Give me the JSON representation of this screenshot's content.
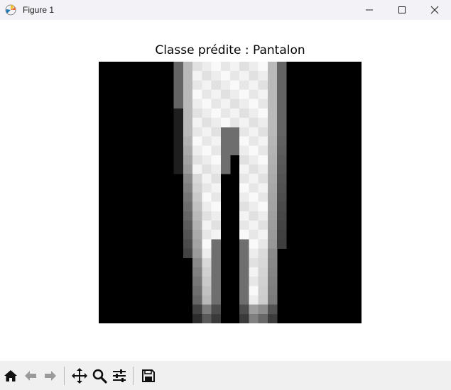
{
  "window": {
    "title": "Figure 1"
  },
  "plot": {
    "title": "Classe prédite : Pantalon"
  },
  "image": {
    "description_type": "grayscale 28x28 pixel image (trousers)",
    "grid_size": 28,
    "colormap": "gray"
  },
  "toolbar": {
    "items": [
      "home-icon",
      "back-icon",
      "forward-icon",
      "pan-icon",
      "zoom-icon",
      "configure-subplots-icon",
      "save-icon"
    ]
  }
}
